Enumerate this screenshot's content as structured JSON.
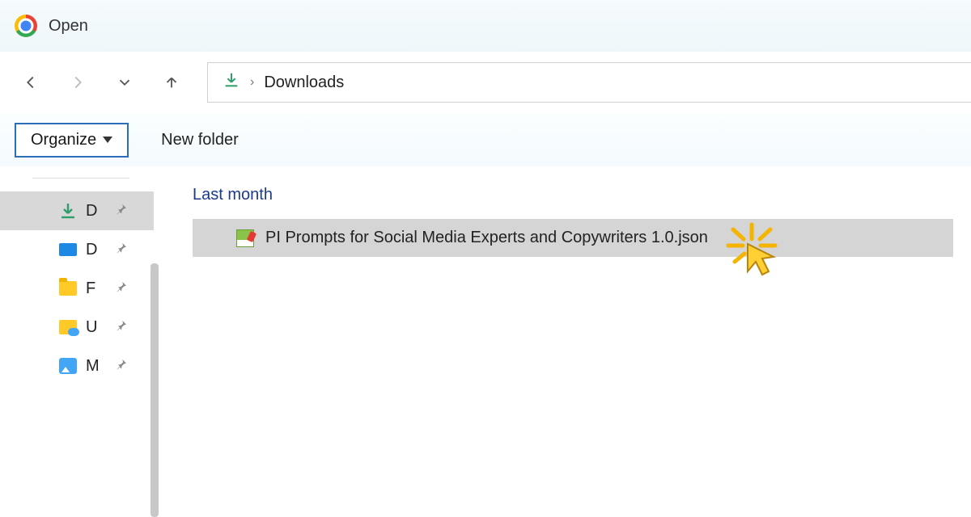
{
  "window": {
    "title": "Open"
  },
  "nav": {
    "location_icon": "download-arrow",
    "breadcrumb_separator": "›",
    "location": "Downloads"
  },
  "toolbar": {
    "organize_label": "Organize",
    "new_folder_label": "New folder"
  },
  "sidebar": {
    "items": [
      {
        "icon": "download",
        "label": "D",
        "pinned": true,
        "selected": true
      },
      {
        "icon": "desktop",
        "label": "D",
        "pinned": true,
        "selected": false
      },
      {
        "icon": "folder",
        "label": "F",
        "pinned": true,
        "selected": false
      },
      {
        "icon": "cloud-folder",
        "label": "U",
        "pinned": true,
        "selected": false
      },
      {
        "icon": "image",
        "label": "M",
        "pinned": true,
        "selected": false
      }
    ]
  },
  "content": {
    "group_label": "Last month",
    "files": [
      {
        "name": "PI Prompts for Social Media Experts and Copywriters 1.0.json",
        "icon": "json-chart",
        "selected": true
      }
    ]
  },
  "colors": {
    "accent": "#1b3a8a",
    "selection": "#d5d5d5",
    "download_green": "#2e9e6b"
  }
}
